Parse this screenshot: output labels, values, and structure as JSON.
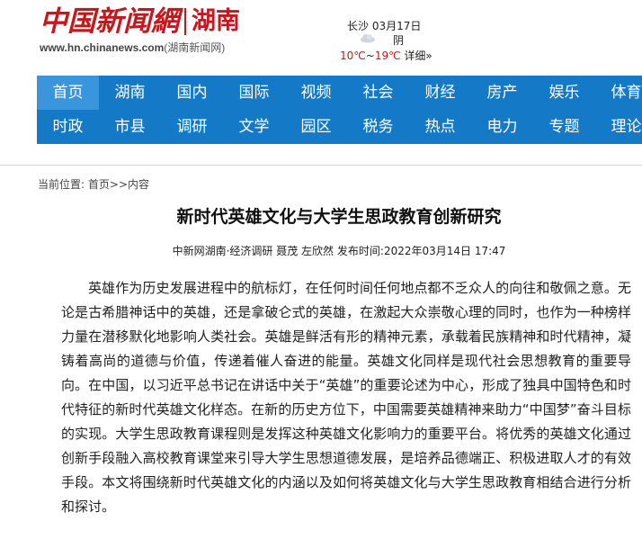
{
  "header": {
    "logo_cn": "中国新闻網",
    "logo_region": "湖南",
    "logo_url_domain": "www.hn.chinanews.com",
    "logo_url_suffix": "(湖南新闻网)"
  },
  "weather": {
    "city": "长沙",
    "date": "03月17日",
    "condition": "阴",
    "low": "10℃",
    "range_sep": "~",
    "high": "19℃",
    "details_link": "详细»",
    "icon": "cloud-icon"
  },
  "nav": {
    "row1": [
      "首页",
      "湖南",
      "国内",
      "国际",
      "视频",
      "社会",
      "财经",
      "房产",
      "娱乐",
      "体育"
    ],
    "row2": [
      "时政",
      "市县",
      "调研",
      "文学",
      "园区",
      "税务",
      "热点",
      "电力",
      "专题",
      "理论"
    ],
    "active": "首页"
  },
  "breadcrumb": {
    "label": "当前位置:",
    "home": "首页",
    "sep": ">>",
    "current": "内容"
  },
  "article": {
    "title": "新时代英雄文化与大学生思政教育创新研究",
    "source": "中新网湖南·经济调研",
    "authors": "聂茂 左欣然",
    "publish_label": "发布时间:",
    "publish_time": "2022年03月14日 17:47",
    "paragraph": "英雄作为历史发展进程中的航标灯，在任何时间任何地点都不乏众人的向往和敬佩之意。无论是古希腊神话中的英雄，还是拿破仑式的英雄，在激起大众崇敬心理的同时，也作为一种榜样力量在潜移默化地影响人类社会。英雄是鲜活有形的精神元素，承载着民族精神和时代精神，凝铸着高尚的道德与价值，传递着催人奋进的能量。英雄文化同样是现代社会思想教育的重要导向。在中国，以习近平总书记在讲话中关于“英雄”的重要论述为中心，形成了独具中国特色和时代特征的新时代英雄文化样态。在新的历史方位下，中国需要英雄精神来助力“中国梦”奋斗目标的实现。大学生思政教育课程则是发挥这种英雄文化影响力的重要平台。将优秀的英雄文化通过创新手段融入高校教育课堂来引导大学生思想道德发展，是培养品德端正、积极进取人才的有效手段。本文将围绕新时代英雄文化的内涵以及如何将英雄文化与大学生思政教育相结合进行分析和探讨。"
  }
}
